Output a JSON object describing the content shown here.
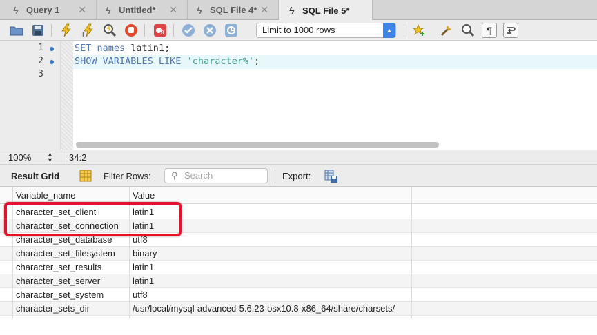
{
  "tabs": [
    {
      "label": "Query 1",
      "close": "✕",
      "active": false
    },
    {
      "label": "Untitled*",
      "close": "✕",
      "active": false
    },
    {
      "label": "SQL File 4*",
      "close": "✕",
      "active": false
    },
    {
      "label": "SQL File 5*",
      "close": "",
      "active": true
    }
  ],
  "toolbar": {
    "limit_value": "Limit to 1000 rows"
  },
  "editor": {
    "line_numbers": [
      "1",
      "2",
      "3"
    ],
    "line1_kw1": "SET",
    "line1_kw2": "names",
    "line1_rest": " latin1;",
    "line2_kw": "SHOW VARIABLES LIKE ",
    "line2_str": "'character%'",
    "line2_end": ";"
  },
  "status": {
    "zoom": "100%",
    "position": "34:2"
  },
  "result_bar": {
    "result_grid": "Result Grid",
    "filter_rows": "Filter Rows:",
    "search_placeholder": "Search",
    "export": "Export:"
  },
  "grid": {
    "columns": [
      "Variable_name",
      "Value"
    ],
    "rows": [
      [
        "character_set_client",
        "latin1"
      ],
      [
        "character_set_connection",
        "latin1"
      ],
      [
        "character_set_database",
        "utf8"
      ],
      [
        "character_set_filesystem",
        "binary"
      ],
      [
        "character_set_results",
        "latin1"
      ],
      [
        "character_set_server",
        "latin1"
      ],
      [
        "character_set_system",
        "utf8"
      ],
      [
        "character_sets_dir",
        "/usr/local/mysql-advanced-5.6.23-osx10.8-x86_64/share/charsets/"
      ]
    ]
  },
  "colors": {
    "highlight": "#e8112d",
    "accent": "#3d84e6"
  }
}
